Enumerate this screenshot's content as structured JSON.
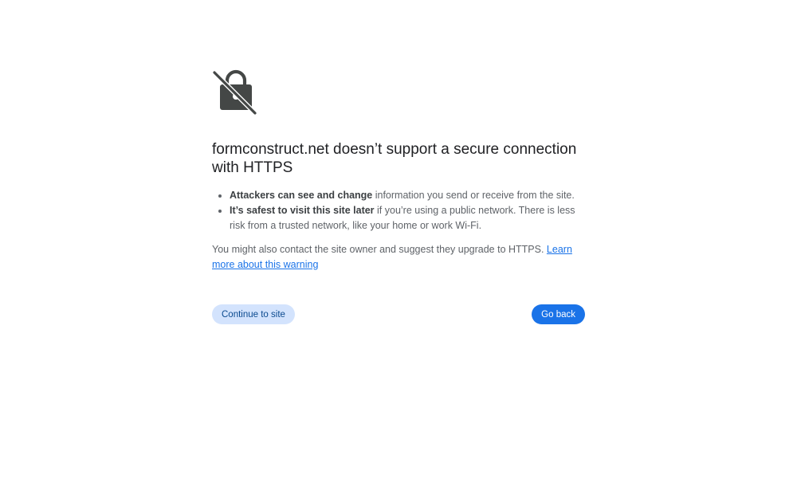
{
  "page": {
    "icon": "broken-lock-icon",
    "title": "formconstruct.net doesn’t support a secure connection with HTTPS",
    "bullets": [
      {
        "bold": "Attackers can see and change",
        "text": " information you send or receive from the site."
      },
      {
        "bold": "It’s safest to visit this site later",
        "text": " if you’re using a public network. There is less risk from a trusted network, like your home or work Wi-Fi."
      }
    ],
    "contact_text": "You might also contact the site owner and suggest they upgrade to HTTPS. ",
    "learn_more_link": "Learn more about this warning"
  },
  "buttons": {
    "continue_label": "Continue to site",
    "back_label": "Go back"
  },
  "colors": {
    "primary": "#1a73e8",
    "secondary_bg": "#d3e3fd",
    "icon": "#444746"
  }
}
